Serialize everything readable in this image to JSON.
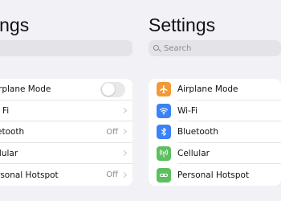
{
  "left_pane": {
    "title": "ings",
    "search_placeholder": "",
    "rows": [
      {
        "label": "rplane Mode",
        "control": "toggle",
        "toggle_on": false
      },
      {
        "label": "Fi"
      },
      {
        "label": "etooth",
        "value": "Off"
      },
      {
        "label": "llular"
      },
      {
        "label": "rsonal Hotspot",
        "value": "Off"
      }
    ]
  },
  "right_pane": {
    "title": "Settings",
    "search_placeholder": "Search",
    "rows": [
      {
        "label": "Airplane Mode",
        "icon": "airplane-icon",
        "icon_color": "#f29a38"
      },
      {
        "label": "Wi-Fi",
        "icon": "wifi-icon",
        "icon_color": "#3b82f6"
      },
      {
        "label": "Bluetooth",
        "icon": "bluetooth-icon",
        "icon_color": "#3b82f6"
      },
      {
        "label": "Cellular",
        "icon": "cellular-icon",
        "icon_color": "#5cc061"
      },
      {
        "label": "Personal Hotspot",
        "icon": "hotspot-icon",
        "icon_color": "#5cc061"
      }
    ]
  }
}
